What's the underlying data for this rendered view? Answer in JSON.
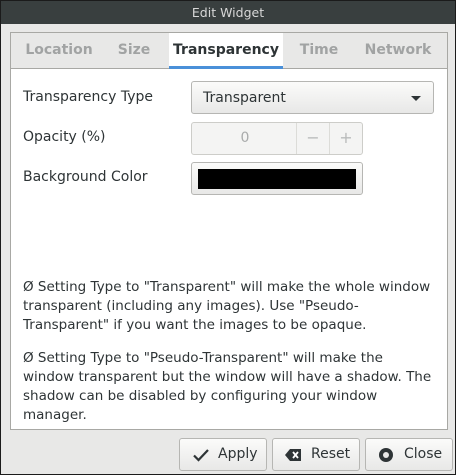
{
  "window": {
    "title": "Edit Widget"
  },
  "tabs": [
    {
      "label": "Location"
    },
    {
      "label": "Size"
    },
    {
      "label": "Transparency"
    },
    {
      "label": "Time"
    },
    {
      "label": "Network"
    }
  ],
  "active_tab": "Transparency",
  "form": {
    "transparency_type_label": "Transparency Type",
    "transparency_type_value": "Transparent",
    "opacity_label": "Opacity (%)",
    "opacity_value": "0",
    "opacity_decrement": "−",
    "opacity_increment": "+",
    "background_color_label": "Background Color",
    "background_color_value": "#000000"
  },
  "notes": [
    "Ø Setting Type to \"Transparent\" will make the whole window transparent (including any images). Use \"Pseudo-Transparent\" if you want the images to be opaque.",
    "Ø Setting Type to \"Pseudo-Transparent\" will make the window transparent but the window will have a shadow. The shadow can be disabled by configuring your window manager."
  ],
  "buttons": {
    "apply_label": "Apply",
    "reset_label": "Reset",
    "close_label": "Close"
  },
  "icons": {
    "apply": "checkmark-icon",
    "reset": "backspace-clear-icon",
    "close": "close-circle-icon"
  },
  "colors": {
    "accent": "#4a90d9",
    "titlebar": "#393f3f"
  }
}
